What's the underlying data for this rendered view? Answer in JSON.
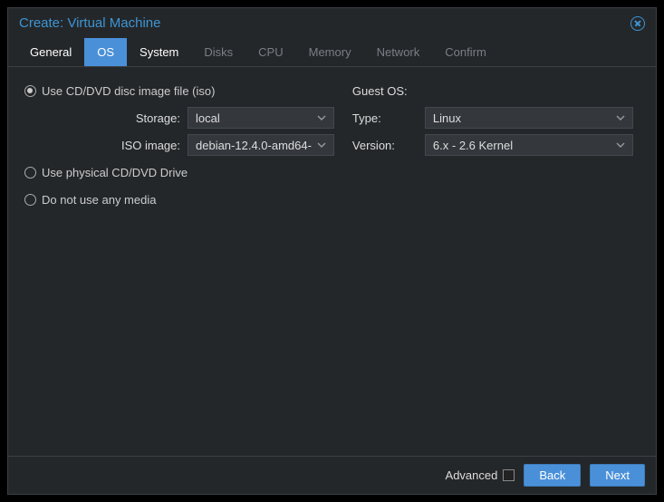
{
  "title": "Create: Virtual Machine",
  "tabs": [
    {
      "label": "General",
      "state": "enabled"
    },
    {
      "label": "OS",
      "state": "selected"
    },
    {
      "label": "System",
      "state": "enabled"
    },
    {
      "label": "Disks",
      "state": "disabled"
    },
    {
      "label": "CPU",
      "state": "disabled"
    },
    {
      "label": "Memory",
      "state": "disabled"
    },
    {
      "label": "Network",
      "state": "disabled"
    },
    {
      "label": "Confirm",
      "state": "disabled"
    }
  ],
  "media": {
    "iso_radio_label": "Use CD/DVD disc image file (iso)",
    "physical_radio_label": "Use physical CD/DVD Drive",
    "none_radio_label": "Do not use any media",
    "selected": "iso",
    "storage_label": "Storage:",
    "storage_value": "local",
    "iso_label": "ISO image:",
    "iso_value": "debian-12.4.0-amd64-"
  },
  "guest": {
    "section_label": "Guest OS:",
    "type_label": "Type:",
    "type_value": "Linux",
    "version_label": "Version:",
    "version_value": "6.x - 2.6 Kernel"
  },
  "footer": {
    "advanced_label": "Advanced",
    "advanced_checked": false,
    "back_label": "Back",
    "next_label": "Next"
  }
}
